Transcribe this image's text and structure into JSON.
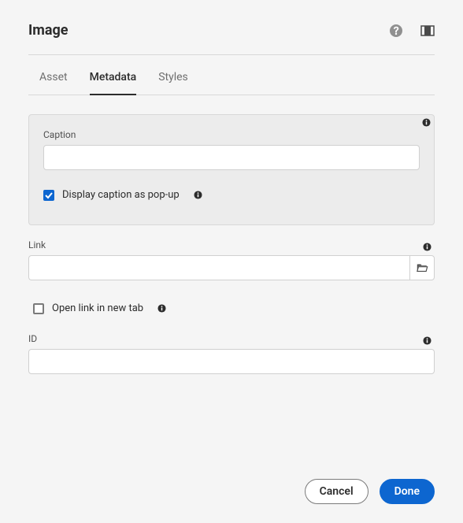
{
  "header": {
    "title": "Image"
  },
  "tabs": [
    {
      "label": "Asset",
      "active": false
    },
    {
      "label": "Metadata",
      "active": true
    },
    {
      "label": "Styles",
      "active": false
    }
  ],
  "fields": {
    "caption": {
      "label": "Caption",
      "value": ""
    },
    "displayPopup": {
      "label": "Display caption as pop-up",
      "checked": true
    },
    "link": {
      "label": "Link",
      "value": ""
    },
    "openNewTab": {
      "label": "Open link in new tab",
      "checked": false
    },
    "id": {
      "label": "ID",
      "value": ""
    }
  },
  "actions": {
    "cancel": "Cancel",
    "done": "Done"
  }
}
